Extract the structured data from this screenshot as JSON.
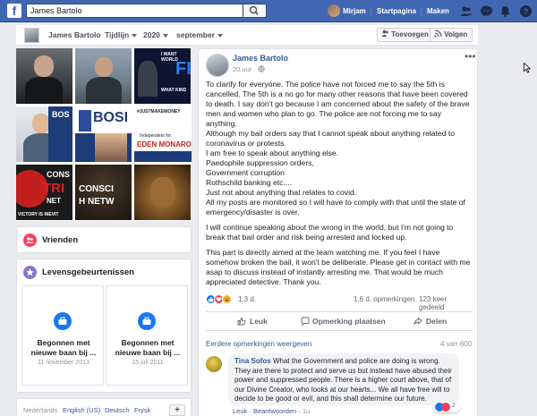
{
  "topbar": {
    "search_value": "James Bartolo",
    "user_name": "Mirjam",
    "links": [
      "Startpagina",
      "Maken"
    ]
  },
  "profile_nav": {
    "name": "James Bartolo",
    "timeline": "Tijdlijn",
    "year": "2020",
    "month": "september",
    "follow_label": "Toevoegen",
    "subscribe_label": "Volgen"
  },
  "photos": {
    "captions": {
      "p3": "FI",
      "p3_sub": "I WANT\nWORLD",
      "p3_sub2": "WHAT KIND",
      "p6": "BOS",
      "p8": "BOSI",
      "p9": "#JUSTMAKEMONEY",
      "p9_sub": "Independent for",
      "p9_name": "EDEN MONARO",
      "p10": "CONS",
      "p10_sub": "TRI",
      "p10_sub2": "NET",
      "p10_foot": "VICTORY IS INEVIT",
      "p11": "CONSCI",
      "p11_sub": "H NETW"
    }
  },
  "friends": {
    "title": "Vrienden"
  },
  "life_events": {
    "title": "Levensgebeurtenissen",
    "events": [
      {
        "title": "Begonnen met nieuwe baan bij ...",
        "date": "11 november 2013"
      },
      {
        "title": "Begonnen met nieuwe baan bij ...",
        "date": "15 juli 2011"
      }
    ]
  },
  "languages": [
    "Nederlands",
    "English (US)",
    "Deutsch",
    "Frysk"
  ],
  "post": {
    "author": "James Bartolo",
    "time": "20 uur",
    "paragraph_1": "To clarify for everyone. The police have not forced me to say the 5th is cancelled. The 5th is a no go for many other reasons that have been covered to death. I say don't go because I am concerned about the safety of the brave men and women who plan to go. The police are not forcing me to say anything.",
    "lines": [
      "Although my bail orders say that I cannot speak about anything related to coronavirus or protests.",
      "I am free to speak about anything else.",
      "Paedophile suppression orders,",
      "Government corruption",
      "Rothschild banking etc....",
      "Just not about anything that relates to covid.",
      "All my posts are monitored so I will have to comply with that until the state of emergency/disaster is over."
    ],
    "paragraph_2": "I will continue speaking about the wrong in the world, but I'm not going to break that bail order and risk being arrested and locked up.",
    "paragraph_3": "This part is directly aimed at the team watching me. If you feel I have somehow broken the bail, it won't be deliberate. Please get in contact with me asap to discuss instead of instantly arresting me. That would be much appreciated detective. Thank you.",
    "reactions_count": "1,3 d.",
    "comments_count": "1,6 d. opmerkingen",
    "shares_count": "123 keer gedeeld",
    "actions": {
      "like": "Leuk",
      "comment": "Opmerking plaatsen",
      "share": "Delen"
    },
    "earlier_comments": "Eerdere opmerkingen weergeven",
    "comment_position": "4 van 600",
    "comment": {
      "author": "Tina Sofos",
      "text": "What the Government and police are doing is wrong. They are there to protect and serve us but instead have abused their power and suppressed people. There is a higher court above, that of our Divine Creator, who looks at our hearts... We all have free will to decide to be good or evil, and this shall determine our future.",
      "reaction_count": "2",
      "like": "Leuk",
      "reply": "Beantwoorden",
      "time": "1u"
    }
  },
  "colors": {
    "brand": "#4267b2",
    "link": "#385898",
    "background": "#e9ebee"
  }
}
